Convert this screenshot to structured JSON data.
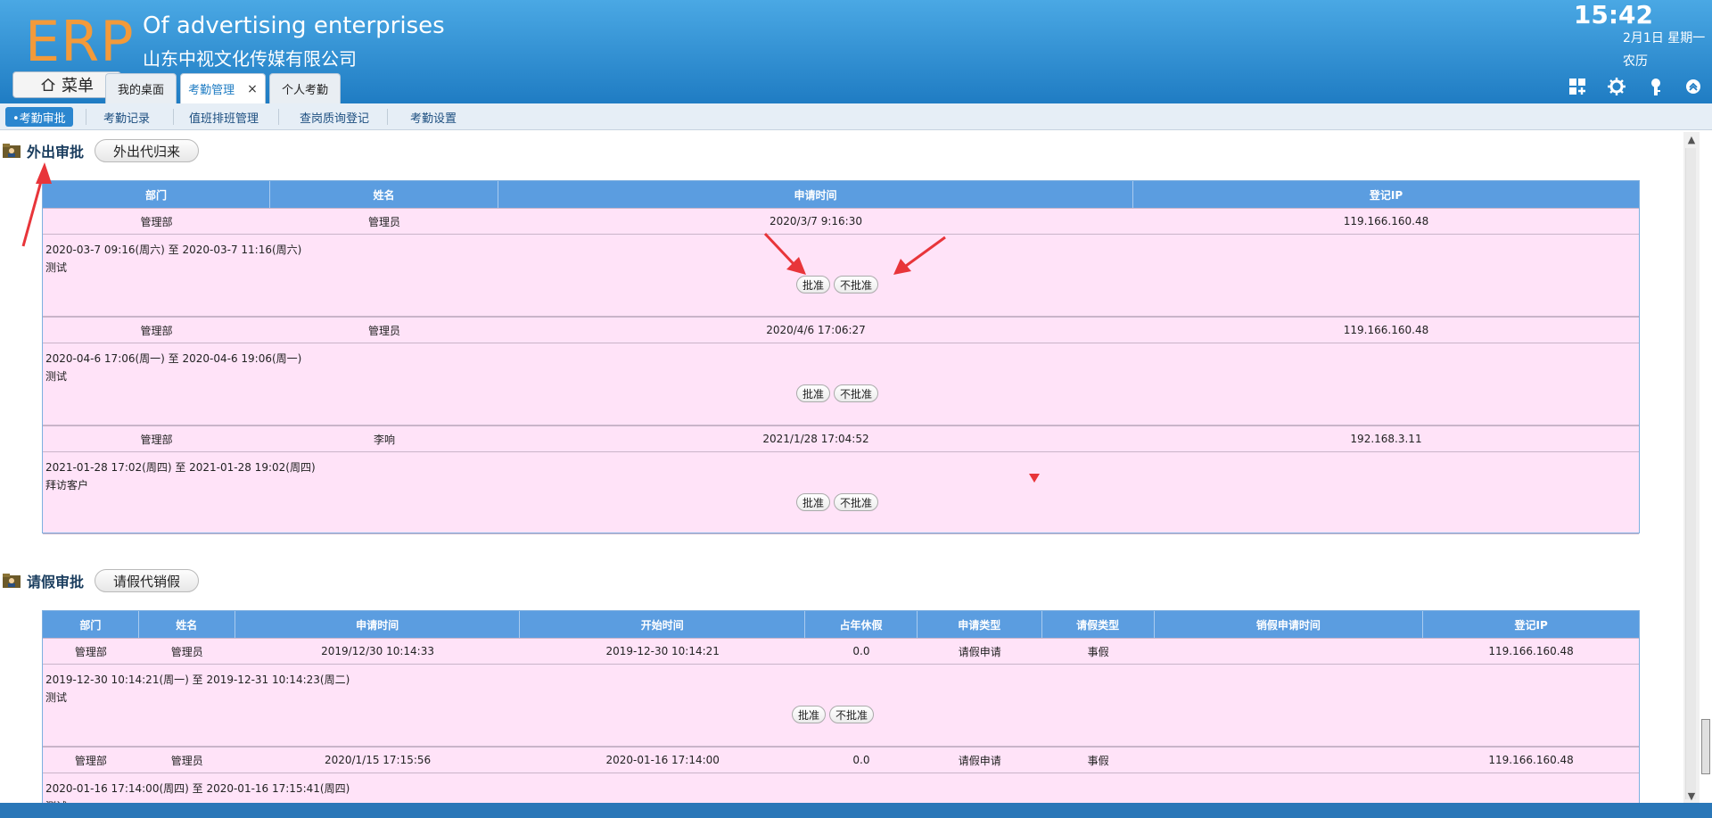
{
  "header": {
    "logo": "ERP",
    "company_en": "Of advertising enterprises",
    "company_cn": "山东中视文化传媒有限公司",
    "clock": "15:42",
    "date": "2月1日 星期一",
    "lunar": "农历",
    "menu_label": "菜单",
    "tabs": [
      {
        "label": "我的桌面"
      },
      {
        "label": "考勤管理",
        "close": "×"
      },
      {
        "label": "个人考勤"
      }
    ]
  },
  "subnav": {
    "items": [
      "•考勤审批",
      "考勤记录",
      "值班排班管理",
      "查岗质询登记",
      "考勤设置"
    ]
  },
  "outing": {
    "title": "外出审批",
    "action": "外出代归来",
    "headers": [
      "部门",
      "姓名",
      "申请时间",
      "登记IP"
    ],
    "approve": "批准",
    "reject": "不批准",
    "rows": [
      {
        "dept": "管理部",
        "name": "管理员",
        "time": "2020/3/7 9:16:30",
        "ip": "119.166.160.48",
        "range": "2020-03-7 09:16(周六) 至 2020-03-7 11:16(周六)",
        "note": "测试"
      },
      {
        "dept": "管理部",
        "name": "管理员",
        "time": "2020/4/6 17:06:27",
        "ip": "119.166.160.48",
        "range": "2020-04-6 17:06(周一) 至 2020-04-6 19:06(周一)",
        "note": "测试"
      },
      {
        "dept": "管理部",
        "name": "李响",
        "time": "2021/1/28 17:04:52",
        "ip": "192.168.3.11",
        "range": "2021-01-28 17:02(周四) 至 2021-01-28 19:02(周四)",
        "note": "拜访客户"
      }
    ]
  },
  "leave": {
    "title": "请假审批",
    "action": "请假代销假",
    "headers": [
      "部门",
      "姓名",
      "申请时间",
      "开始时间",
      "占年休假",
      "申请类型",
      "请假类型",
      "销假申请时间",
      "登记IP"
    ],
    "approve": "批准",
    "reject": "不批准",
    "rows": [
      {
        "dept": "管理部",
        "name": "管理员",
        "applied": "2019/12/30 10:14:33",
        "start": "2019-12-30 10:14:21",
        "annual": "0.0",
        "apply_type": "请假申请",
        "leave_type": "事假",
        "cancel_time": "",
        "ip": "119.166.160.48",
        "range": "2019-12-30 10:14:21(周一) 至 2019-12-31 10:14:23(周二)",
        "note": "测试"
      },
      {
        "dept": "管理部",
        "name": "管理员",
        "applied": "2020/1/15 17:15:56",
        "start": "2020-01-16 17:14:00",
        "annual": "0.0",
        "apply_type": "请假申请",
        "leave_type": "事假",
        "cancel_time": "",
        "ip": "119.166.160.48",
        "range": "2020-01-16 17:14:00(周四) 至 2020-01-16 17:15:41(周四)",
        "note": "测试"
      }
    ]
  },
  "colors": {
    "header_blue": "#2b86cf",
    "table_head": "#5b9de0",
    "row_pink": "#ffe3f8",
    "logo_orange": "#f39a3a",
    "annotation_red": "#e8353a"
  }
}
